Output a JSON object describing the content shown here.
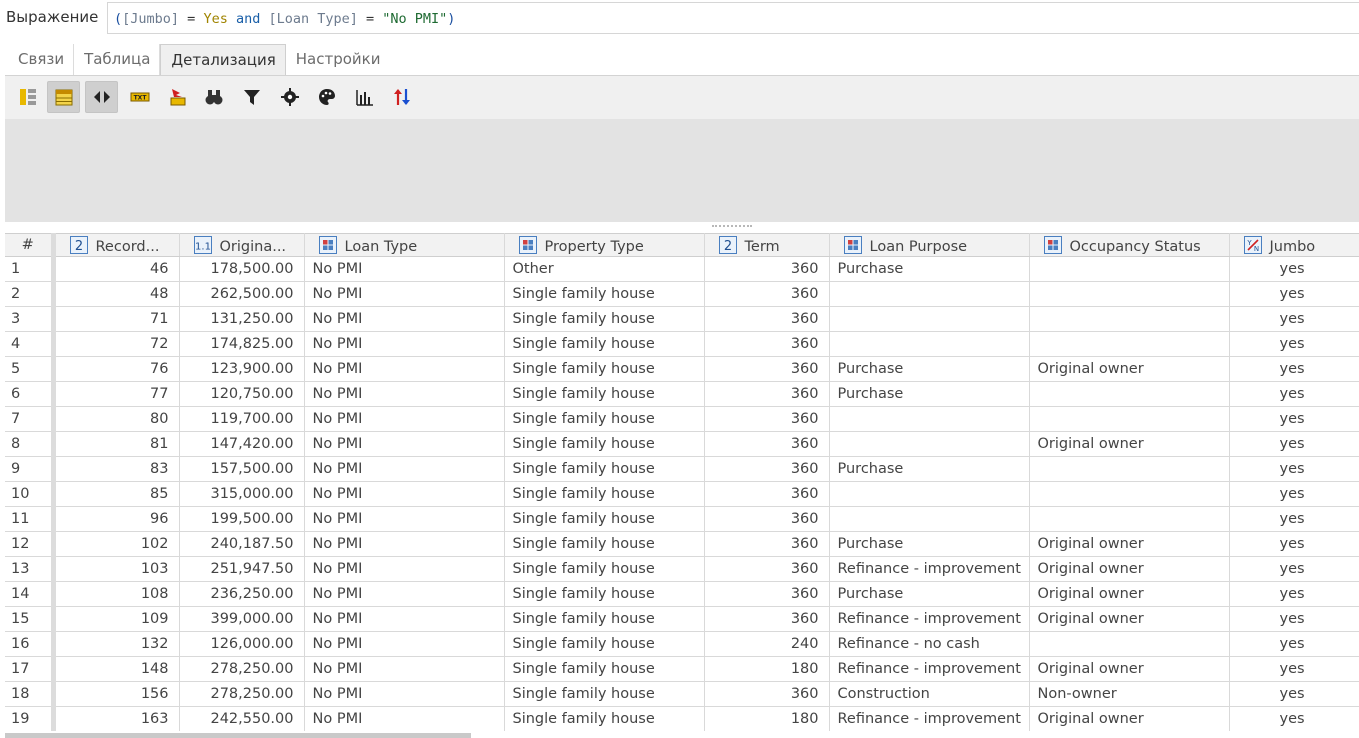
{
  "expression": {
    "label": "Выражение",
    "tokens": [
      {
        "t": "(",
        "c": "paren"
      },
      {
        "t": "[Jumbo]",
        "c": "field"
      },
      {
        "t": " = ",
        "c": "op"
      },
      {
        "t": "Yes",
        "c": "val"
      },
      {
        "t": " and ",
        "c": "kw"
      },
      {
        "t": "[Loan Type]",
        "c": "field"
      },
      {
        "t": " = ",
        "c": "op"
      },
      {
        "t": "\"No PMI\"",
        "c": "str"
      },
      {
        "t": ")",
        "c": "paren"
      }
    ]
  },
  "tabs": [
    {
      "label": "Связи",
      "active": false
    },
    {
      "label": "Таблица",
      "active": false
    },
    {
      "label": "Детализация",
      "active": true
    },
    {
      "label": "Настройки",
      "active": false
    }
  ],
  "toolbar": [
    {
      "icon": "columns-icon",
      "pressed": false
    },
    {
      "icon": "table-icon",
      "pressed": true
    },
    {
      "icon": "fit-width-icon",
      "pressed": true
    },
    {
      "icon": "txt-icon",
      "pressed": false
    },
    {
      "icon": "export-icon",
      "pressed": false
    },
    {
      "icon": "binoculars-icon",
      "pressed": false
    },
    {
      "icon": "filter-icon",
      "pressed": false
    },
    {
      "icon": "gear-icon",
      "pressed": false
    },
    {
      "icon": "palette-icon",
      "pressed": false
    },
    {
      "icon": "bar-chart-icon",
      "pressed": false
    },
    {
      "icon": "sort-icon",
      "pressed": false
    }
  ],
  "grid": {
    "columns": [
      {
        "label": "#",
        "type": "rownum"
      },
      {
        "label": "Record...",
        "type": "int"
      },
      {
        "label": "Origina...",
        "type": "decimal"
      },
      {
        "label": "Loan Type",
        "type": "cat"
      },
      {
        "label": "Property Type",
        "type": "cat"
      },
      {
        "label": "Term",
        "type": "int"
      },
      {
        "label": "Loan Purpose",
        "type": "cat"
      },
      {
        "label": "Occupancy Status",
        "type": "cat"
      },
      {
        "label": "Jumbo",
        "type": "bool"
      }
    ],
    "rows": [
      [
        "1",
        "46",
        "178,500.00",
        "No PMI",
        "Other",
        "360",
        "Purchase",
        "",
        "yes"
      ],
      [
        "2",
        "48",
        "262,500.00",
        "No PMI",
        "Single family house",
        "360",
        "",
        "",
        "yes"
      ],
      [
        "3",
        "71",
        "131,250.00",
        "No PMI",
        "Single family house",
        "360",
        "",
        "",
        "yes"
      ],
      [
        "4",
        "72",
        "174,825.00",
        "No PMI",
        "Single family house",
        "360",
        "",
        "",
        "yes"
      ],
      [
        "5",
        "76",
        "123,900.00",
        "No PMI",
        "Single family house",
        "360",
        "Purchase",
        "Original owner",
        "yes"
      ],
      [
        "6",
        "77",
        "120,750.00",
        "No PMI",
        "Single family house",
        "360",
        "Purchase",
        "",
        "yes"
      ],
      [
        "7",
        "80",
        "119,700.00",
        "No PMI",
        "Single family house",
        "360",
        "",
        "",
        "yes"
      ],
      [
        "8",
        "81",
        "147,420.00",
        "No PMI",
        "Single family house",
        "360",
        "",
        "Original owner",
        "yes"
      ],
      [
        "9",
        "83",
        "157,500.00",
        "No PMI",
        "Single family house",
        "360",
        "Purchase",
        "",
        "yes"
      ],
      [
        "10",
        "85",
        "315,000.00",
        "No PMI",
        "Single family house",
        "360",
        "",
        "",
        "yes"
      ],
      [
        "11",
        "96",
        "199,500.00",
        "No PMI",
        "Single family house",
        "360",
        "",
        "",
        "yes"
      ],
      [
        "12",
        "102",
        "240,187.50",
        "No PMI",
        "Single family house",
        "360",
        "Purchase",
        "Original owner",
        "yes"
      ],
      [
        "13",
        "103",
        "251,947.50",
        "No PMI",
        "Single family house",
        "360",
        "Refinance - improvement",
        "Original owner",
        "yes"
      ],
      [
        "14",
        "108",
        "236,250.00",
        "No PMI",
        "Single family house",
        "360",
        "Purchase",
        "Original owner",
        "yes"
      ],
      [
        "15",
        "109",
        "399,000.00",
        "No PMI",
        "Single family house",
        "360",
        "Refinance - improvement",
        "Original owner",
        "yes"
      ],
      [
        "16",
        "132",
        "126,000.00",
        "No PMI",
        "Single family house",
        "240",
        "Refinance - no cash",
        "",
        "yes"
      ],
      [
        "17",
        "148",
        "278,250.00",
        "No PMI",
        "Single family house",
        "180",
        "Refinance - improvement",
        "Original owner",
        "yes"
      ],
      [
        "18",
        "156",
        "278,250.00",
        "No PMI",
        "Single family house",
        "360",
        "Construction",
        "Non-owner",
        "yes"
      ],
      [
        "19",
        "163",
        "242,550.00",
        "No PMI",
        "Single family house",
        "180",
        "Refinance - improvement",
        "Original owner",
        "yes"
      ]
    ]
  }
}
